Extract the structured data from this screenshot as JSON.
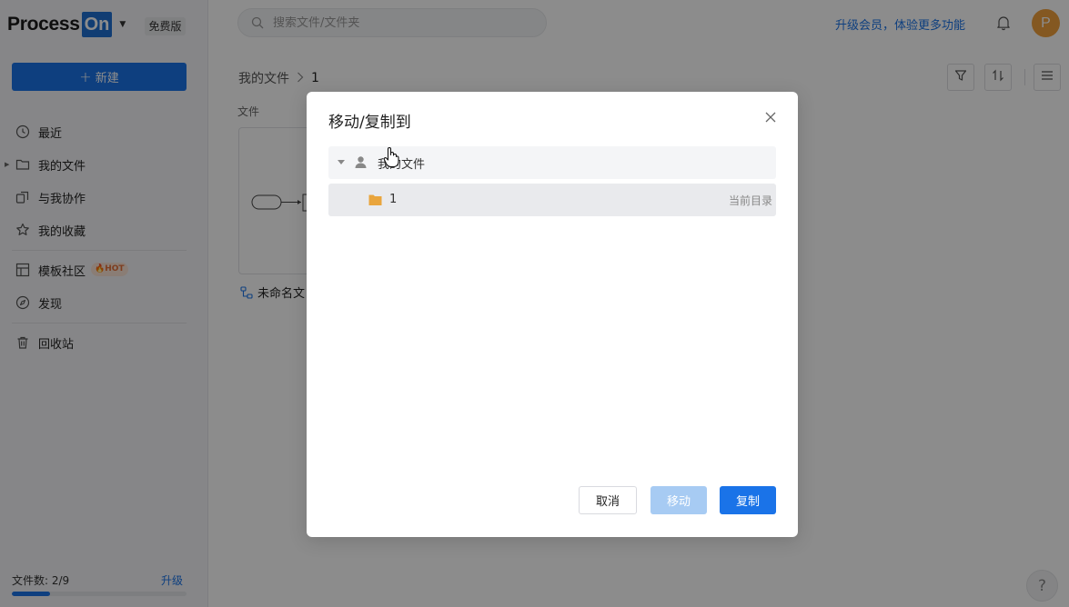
{
  "brand": {
    "name_part1": "Process",
    "name_part2": "On",
    "edition": "免费版"
  },
  "sidebar": {
    "new_button": "新建",
    "items": [
      {
        "label": "最近",
        "icon": "clock-icon"
      },
      {
        "label": "我的文件",
        "icon": "folder-icon"
      },
      {
        "label": "与我协作",
        "icon": "collaborate-icon"
      },
      {
        "label": "我的收藏",
        "icon": "star-icon"
      },
      {
        "label": "模板社区",
        "icon": "template-icon",
        "badge": "HOT"
      },
      {
        "label": "发现",
        "icon": "compass-icon"
      },
      {
        "label": "回收站",
        "icon": "trash-icon"
      }
    ],
    "file_count_label": "文件数: 2/9",
    "upgrade_label": "升级",
    "file_usage_fraction": 0.22
  },
  "header": {
    "search_placeholder": "搜索文件/文件夹",
    "promo_text": "升级会员，体验更多功能",
    "avatar_initial": "P"
  },
  "main": {
    "breadcrumb_root": "我的文件",
    "breadcrumb_current": "1",
    "section_label": "文件",
    "file_name": "未命名文"
  },
  "modal": {
    "title": "移动/复制到",
    "tree_root_label": "我的文件",
    "tree_child_label": "1",
    "current_tag": "当前目录",
    "cancel_label": "取消",
    "move_label": "移动",
    "copy_label": "复制"
  },
  "colors": {
    "accent": "#1a73e8",
    "avatar": "#f0a13d",
    "folder": "#e9a53d",
    "hot": "#e3703a"
  }
}
